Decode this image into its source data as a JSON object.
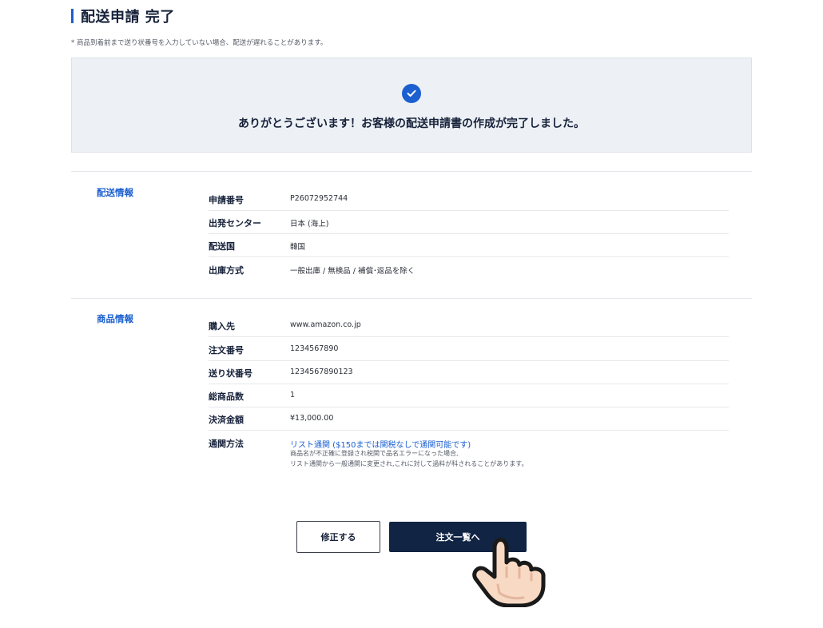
{
  "page": {
    "title": "配送申請 完了",
    "note": "* 商品到着前まで送り状番号を入力していない場合、配送が遅れることがあります。"
  },
  "completion": {
    "message": "ありがとうございます！お客様の配送申請書の作成が完了しました。"
  },
  "shipping_info": {
    "section_label": "配送情報",
    "rows": [
      {
        "label": "申請番号",
        "value": "P26072952744"
      },
      {
        "label": "出発センター",
        "value": "日本 (海上)"
      },
      {
        "label": "配送国",
        "value": "韓国"
      },
      {
        "label": "出庫方式",
        "value": "一般出庫 / 無検品 / 補償･返品を除く"
      }
    ]
  },
  "product_info": {
    "section_label": "商品情報",
    "rows": [
      {
        "label": "購入先",
        "value": "www.amazon.co.jp"
      },
      {
        "label": "注文番号",
        "value": "1234567890"
      },
      {
        "label": "送り状番号",
        "value": "1234567890123"
      },
      {
        "label": "総商品数",
        "value": "1"
      },
      {
        "label": "決済金額",
        "value": "¥13,000.00"
      }
    ],
    "customs": {
      "label": "通関方法",
      "value": "リスト通関 ($150までは関税なしで通関可能です)",
      "note_line1": "商品名が不正確に登録され税関で品名エラーになった場合,",
      "note_line2": "リスト通関から一般通関に変更され,これに対して過料が科されることがあります。"
    }
  },
  "buttons": {
    "edit": "修正する",
    "order_list": "注文一覧へ"
  },
  "colors": {
    "accent": "#1b5fd0",
    "navy": "#112443",
    "panel": "#edf1f5"
  },
  "icons": {
    "check": "check-circle-icon",
    "pointer": "pointing-hand-icon"
  }
}
